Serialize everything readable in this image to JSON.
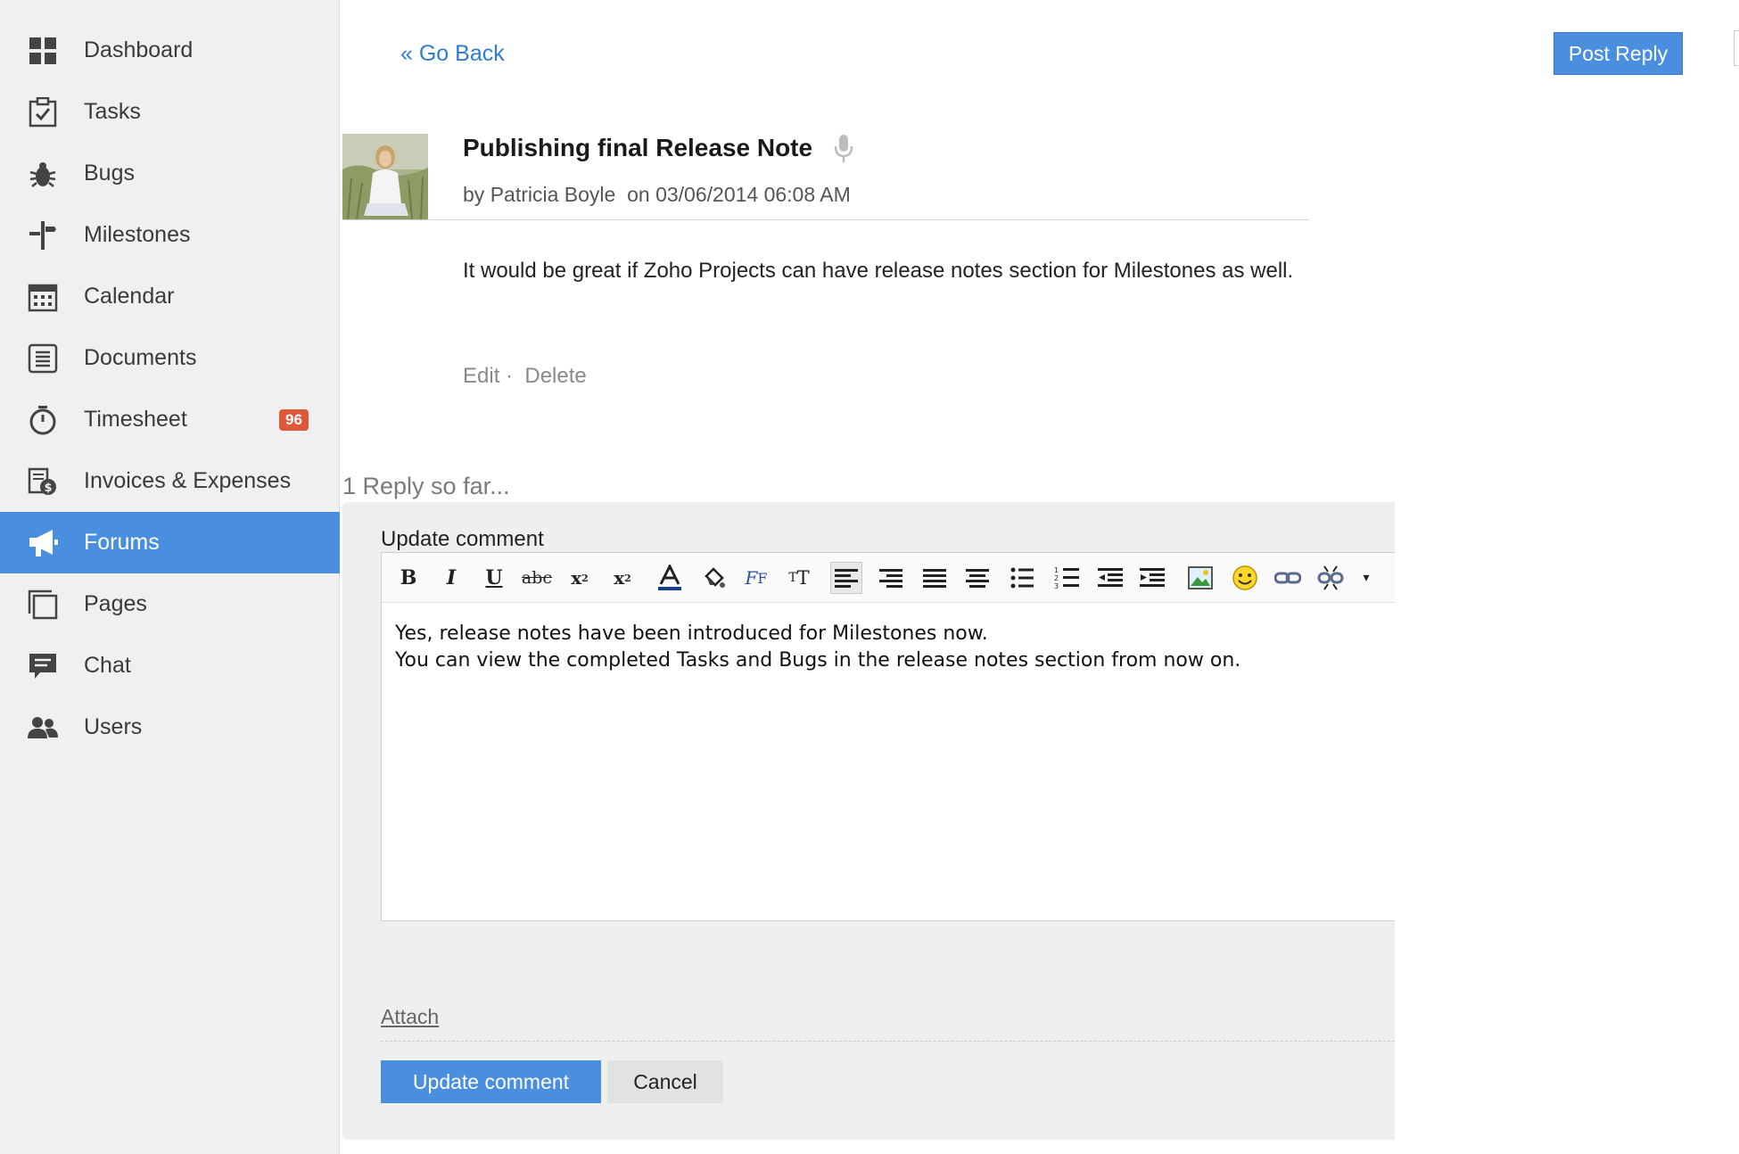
{
  "sidebar": {
    "items": [
      {
        "label": "Dashboard",
        "icon": "dashboard-icon"
      },
      {
        "label": "Tasks",
        "icon": "tasks-icon"
      },
      {
        "label": "Bugs",
        "icon": "bug-icon"
      },
      {
        "label": "Milestones",
        "icon": "milestone-icon"
      },
      {
        "label": "Calendar",
        "icon": "calendar-icon"
      },
      {
        "label": "Documents",
        "icon": "documents-icon"
      },
      {
        "label": "Timesheet",
        "icon": "stopwatch-icon",
        "badge": "96"
      },
      {
        "label": "Invoices & Expenses",
        "icon": "invoice-icon"
      },
      {
        "label": "Forums",
        "icon": "megaphone-icon",
        "active": true
      },
      {
        "label": "Pages",
        "icon": "pages-icon"
      },
      {
        "label": "Chat",
        "icon": "chat-icon"
      },
      {
        "label": "Users",
        "icon": "users-icon"
      }
    ]
  },
  "header": {
    "go_back": "« Go Back",
    "post_reply": "Post Reply"
  },
  "post": {
    "title": "Publishing final Release Note",
    "by_label": "by",
    "author": "Patricia Boyle",
    "on_label": "on",
    "date": "03/06/2014 06:08 AM",
    "body": "It would be great if Zoho Projects can have release notes section for Milestones as well.",
    "edit": "Edit",
    "separator": "·",
    "delete": "Delete"
  },
  "replies": {
    "count_text": "1 Reply so far..."
  },
  "reply_form": {
    "label": "Update comment",
    "text": "Yes, release notes have been introduced for Milestones now.\nYou can view the completed Tasks and Bugs in the release notes section from now on.",
    "attach": "Attach",
    "update_button": "Update comment",
    "cancel_button": "Cancel"
  },
  "colors": {
    "accent": "#4a8ee0",
    "badge": "#e0583a",
    "link": "#2f7dd1"
  }
}
